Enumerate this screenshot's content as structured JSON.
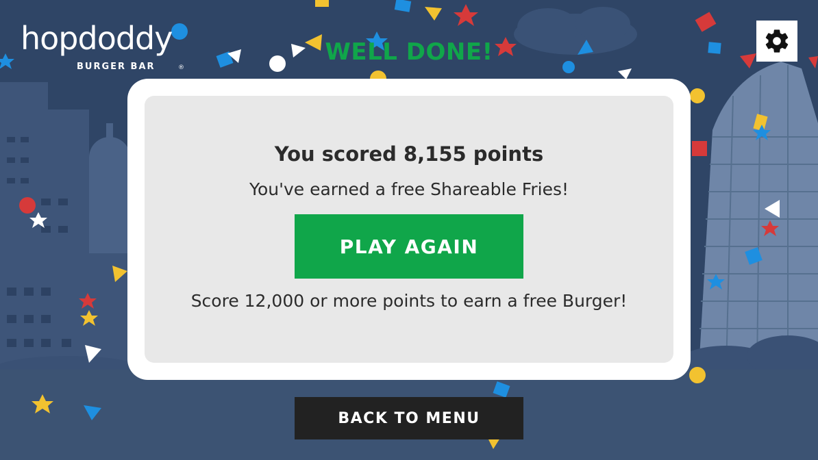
{
  "brand": {
    "name": "hopdoddy",
    "tagline": "BURGER BAR",
    "registered_mark": "®"
  },
  "header": {
    "headline": "WELL DONE!"
  },
  "settings": {
    "icon": "gear-icon"
  },
  "result": {
    "score_text": "You scored 8,155 points",
    "reward_text": "You've earned a free Shareable Fries!",
    "next_goal_text": "Score 12,000 or more points to earn a free Burger!"
  },
  "buttons": {
    "play_again": "PLAY AGAIN",
    "back_to_menu": "BACK TO MENU"
  },
  "colors": {
    "background": "#2f4566",
    "accent_green": "#10a64a",
    "card_white": "#ffffff",
    "panel_grey": "#e8e8e8",
    "dark_button": "#222222",
    "confetti_red": "#d63a3a",
    "confetti_blue": "#1e8fe0",
    "confetti_yellow": "#f2c230",
    "confetti_white": "#ffffff"
  }
}
